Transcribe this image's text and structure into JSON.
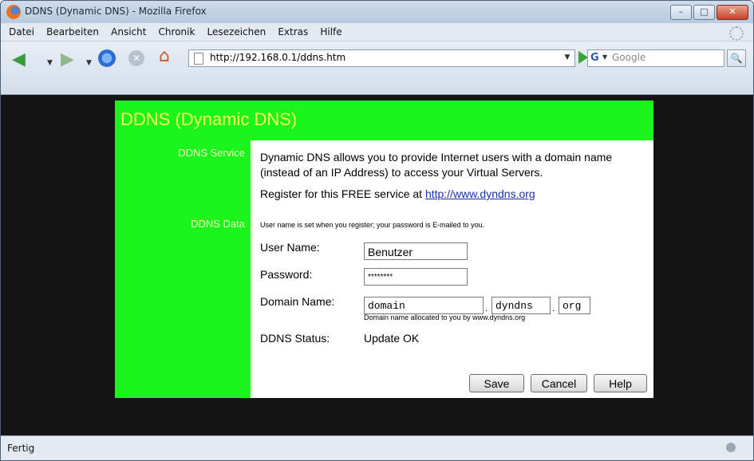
{
  "window": {
    "title": "DDNS (Dynamic DNS) - Mozilla Firefox",
    "buttons": [
      "–",
      "□",
      "✕"
    ]
  },
  "menu": [
    "Datei",
    "Bearbeiten",
    "Ansicht",
    "Chronik",
    "Lesezeichen",
    "Extras",
    "Hilfe"
  ],
  "nav": {
    "url": "http://192.168.0.1/ddns.htm",
    "search_placeholder": "Google",
    "search_engine": "G"
  },
  "page": {
    "title": "DDNS (Dynamic DNS)",
    "sections": {
      "service": "DDNS Service",
      "data": "DDNS Data"
    },
    "description": "Dynamic DNS allows you to provide Internet users with a domain name (instead of an IP Address) to access your Virtual Servers.",
    "register_text": "Register for this FREE service at",
    "register_link": "http://www.dyndns.org",
    "note": "User name is set when you register; your password is E-mailed to you.",
    "fields": {
      "username_label": "User Name:",
      "username_value": "Benutzer",
      "password_label": "Password:",
      "password_value": "********",
      "domain_label": "Domain Name:",
      "domain_part1": "domain",
      "domain_part2": "dyndns",
      "domain_part3": "org",
      "domain_hint": "Domain name allocated to you by www.dyndns.org",
      "status_label": "DDNS Status:",
      "status_value": "Update OK"
    },
    "buttons": {
      "save": "Save",
      "cancel": "Cancel",
      "help": "Help"
    }
  },
  "statusbar": {
    "text": "Fertig"
  },
  "colors": {
    "header_green": "#1cf51c",
    "title_yellow": "#f4f75a",
    "page_bg": "#141414"
  }
}
